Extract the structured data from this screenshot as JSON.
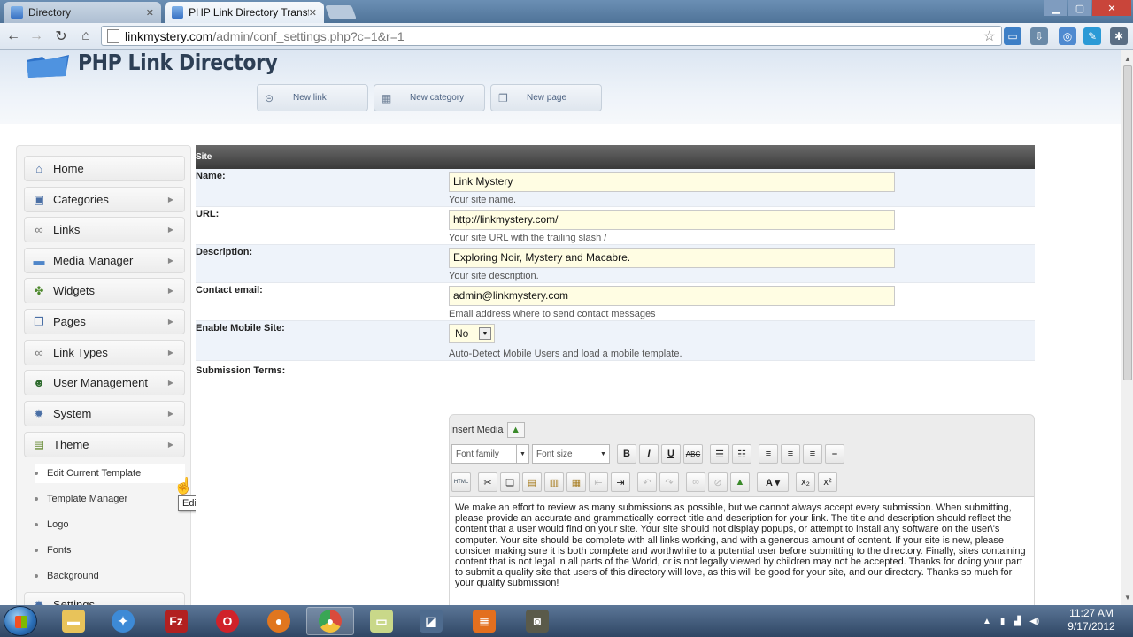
{
  "browser": {
    "tabs": [
      {
        "title": "Directory",
        "active": false
      },
      {
        "title": "PHP Link Directory Transfo",
        "active": true
      }
    ],
    "url_host": "linkmystery.com",
    "url_path": "/admin/conf_settings.php?c=1&r=1"
  },
  "header": {
    "logo_text": "PHP Link Directory",
    "quick_buttons": [
      "New link",
      "New category",
      "New page"
    ]
  },
  "sidebar": {
    "items": [
      {
        "label": "Home",
        "icon": "home-icon",
        "has_arrow": false
      },
      {
        "label": "Categories",
        "icon": "categories-icon",
        "has_arrow": true
      },
      {
        "label": "Links",
        "icon": "link-icon",
        "has_arrow": true
      },
      {
        "label": "Media Manager",
        "icon": "folder-icon",
        "has_arrow": true
      },
      {
        "label": "Widgets",
        "icon": "widgets-icon",
        "has_arrow": true
      },
      {
        "label": "Pages",
        "icon": "page-icon",
        "has_arrow": true
      },
      {
        "label": "Link Types",
        "icon": "link-icon",
        "has_arrow": true
      },
      {
        "label": "User Management",
        "icon": "user-icon",
        "has_arrow": true
      },
      {
        "label": "System",
        "icon": "gear-icon",
        "has_arrow": true
      },
      {
        "label": "Theme",
        "icon": "theme-icon",
        "has_arrow": true
      }
    ],
    "theme_subitems": [
      "Edit Current Template",
      "Template Manager",
      "Logo",
      "Fonts",
      "Background"
    ],
    "partial_item": "Settings"
  },
  "tooltip": "Edit Current Template",
  "form": {
    "section_title": "Site",
    "name": {
      "label": "Name:",
      "value": "Link Mystery",
      "hint": "Your site name."
    },
    "url": {
      "label": "URL:",
      "value": "http://linkmystery.com/",
      "hint": "Your site URL with the trailing slash /"
    },
    "description": {
      "label": "Description:",
      "value": "Exploring Noir, Mystery and Macabre.",
      "hint": "Your site description."
    },
    "contact_email": {
      "label": "Contact email:",
      "value": "admin@linkmystery.com",
      "hint": "Email address where to send contact messages"
    },
    "mobile": {
      "label": "Enable Mobile Site:",
      "value": "No",
      "hint": "Auto-Detect Mobile Users and load a mobile template."
    },
    "terms": {
      "label": "Submission Terms:",
      "insert_media": "Insert Media",
      "font_family": "Font family",
      "font_size": "Font size",
      "content": "We make an effort to review as many submissions as possible, but we cannot always accept every submission. When submitting, please provide an accurate and grammatically correct title and description for your link. The title and description should reflect the content that a user would find on your site. Your site should not display popups, or attempt to install any software on the user\\'s computer. Your site should be complete with all links working, and with a generous amount of content. If your site is new, please consider making sure it is both complete and worthwhile to a potential user before submitting to the directory. Finally, sites containing content that is not legal in all parts of the World, or is not legally viewed by children may not be accepted. Thanks for doing your part to submit a quality site that users of this directory will love, as this will be good for your site, and our directory. Thanks so much for your quality submission!"
    }
  },
  "taskbar": {
    "time": "11:27 AM",
    "date": "9/17/2012"
  }
}
